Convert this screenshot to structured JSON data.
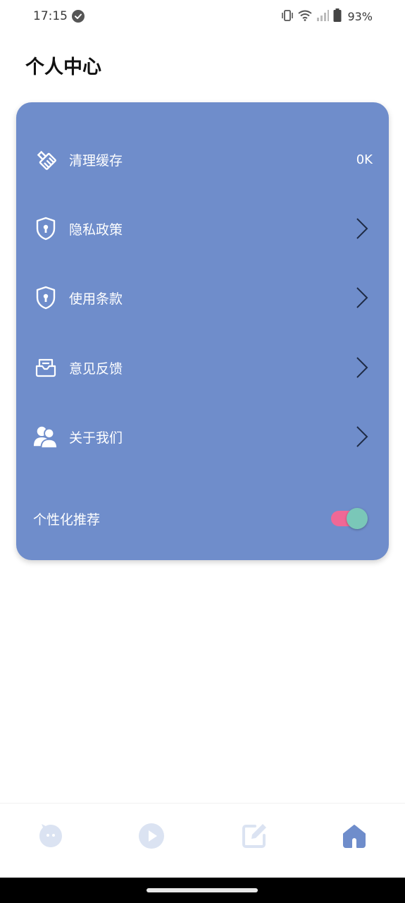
{
  "status_bar": {
    "time": "17:15",
    "battery_percent": "93%"
  },
  "header": {
    "title": "个人中心"
  },
  "settings_card": {
    "items": [
      {
        "label": "清理缓存",
        "value": "0K",
        "icon": "broom-icon"
      },
      {
        "label": "隐私政策",
        "icon": "shield-lock-icon"
      },
      {
        "label": "使用条款",
        "icon": "shield-lock-icon"
      },
      {
        "label": "意见反馈",
        "icon": "mail-tray-icon"
      },
      {
        "label": "关于我们",
        "icon": "users-icon"
      }
    ],
    "personalized_recommendation": {
      "label": "个性化推荐",
      "enabled": true
    }
  },
  "bottom_nav": {
    "items": [
      {
        "icon": "chat-face-icon",
        "active": false
      },
      {
        "icon": "play-circle-icon",
        "active": false
      },
      {
        "icon": "edit-icon",
        "active": false
      },
      {
        "icon": "home-icon",
        "active": true
      }
    ]
  },
  "colors": {
    "card_background": "#6f8dcb",
    "toggle_track": "#f06896",
    "toggle_knob": "#7ac7b8",
    "nav_active": "#6f8dcb",
    "nav_inactive": "#dbe3f2"
  }
}
